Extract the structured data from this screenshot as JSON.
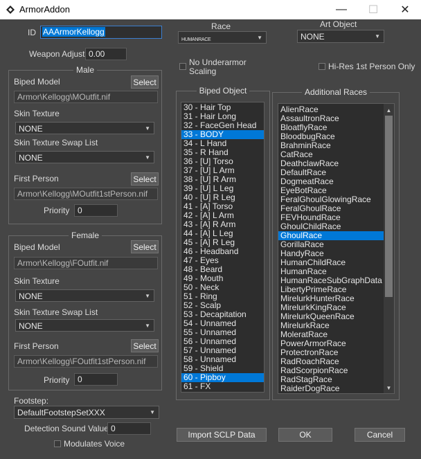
{
  "window": {
    "title": "ArmorAddon"
  },
  "id": {
    "label": "ID",
    "value": "AAArmorKellogg"
  },
  "weapon_adjust": {
    "label": "Weapon Adjust",
    "value": "0.00"
  },
  "male": {
    "title": "Male",
    "biped_model": {
      "label": "Biped Model",
      "button": "Select",
      "value": "Armor\\Kellogg\\MOutfit.nif"
    },
    "skin_texture": {
      "label": "Skin Texture",
      "value": "NONE"
    },
    "skin_swap": {
      "label": "Skin Texture Swap List",
      "value": "NONE"
    },
    "first_person": {
      "label": "First Person",
      "button": "Select",
      "value": "Armor\\Kellogg\\MOutfit1stPerson.nif"
    },
    "priority": {
      "label": "Priority",
      "value": "0"
    }
  },
  "female": {
    "title": "Female",
    "biped_model": {
      "label": "Biped Model",
      "button": "Select",
      "value": "Armor\\Kellogg\\FOutfit.nif"
    },
    "skin_texture": {
      "label": "Skin Texture",
      "value": "NONE"
    },
    "skin_swap": {
      "label": "Skin Texture Swap List",
      "value": "NONE"
    },
    "first_person": {
      "label": "First Person",
      "button": "Select",
      "value": "Armor\\Kellogg\\FOutfit1stPerson.nif"
    },
    "priority": {
      "label": "Priority",
      "value": "0"
    }
  },
  "footstep": {
    "label": "Footstep:",
    "value": "DefaultFootstepSetXXX"
  },
  "detection_sound": {
    "label": "Detection Sound Value",
    "value": "0"
  },
  "modulates_voice": {
    "label": "Modulates Voice",
    "checked": false
  },
  "race": {
    "label": "Race",
    "value": "HUMANRACE"
  },
  "art_object": {
    "label": "Art Object",
    "value": "NONE"
  },
  "no_underarmor": {
    "label_line1": "No Underarmor",
    "label_line2": "Scaling",
    "checked": false
  },
  "hires_1st": {
    "label": "Hi-Res 1st Person Only",
    "checked": false
  },
  "biped_object": {
    "title": "Biped Object",
    "items": [
      {
        "text": "30 - Hair Top",
        "selected": false
      },
      {
        "text": "31 - Hair Long",
        "selected": false
      },
      {
        "text": "32 - FaceGen Head",
        "selected": false
      },
      {
        "text": "33 - BODY",
        "selected": true
      },
      {
        "text": "34 - L Hand",
        "selected": false
      },
      {
        "text": "35 - R Hand",
        "selected": false
      },
      {
        "text": "36 - [U] Torso",
        "selected": false
      },
      {
        "text": "37 - [U] L Arm",
        "selected": false
      },
      {
        "text": "38 - [U] R Arm",
        "selected": false
      },
      {
        "text": "39 - [U] L Leg",
        "selected": false
      },
      {
        "text": "40 - [U] R Leg",
        "selected": false
      },
      {
        "text": "41 - [A] Torso",
        "selected": false
      },
      {
        "text": "42 - [A] L Arm",
        "selected": false
      },
      {
        "text": "43 - [A] R Arm",
        "selected": false
      },
      {
        "text": "44 - [A] L Leg",
        "selected": false
      },
      {
        "text": "45 - [A] R Leg",
        "selected": false
      },
      {
        "text": "46 - Headband",
        "selected": false
      },
      {
        "text": "47 - Eyes",
        "selected": false
      },
      {
        "text": "48 - Beard",
        "selected": false
      },
      {
        "text": "49 - Mouth",
        "selected": false
      },
      {
        "text": "50 - Neck",
        "selected": false
      },
      {
        "text": "51 - Ring",
        "selected": false
      },
      {
        "text": "52 - Scalp",
        "selected": false
      },
      {
        "text": "53 - Decapitation",
        "selected": false
      },
      {
        "text": "54 - Unnamed",
        "selected": false
      },
      {
        "text": "55 - Unnamed",
        "selected": false
      },
      {
        "text": "56 - Unnamed",
        "selected": false
      },
      {
        "text": "57 - Unnamed",
        "selected": false
      },
      {
        "text": "58 - Unnamed",
        "selected": false
      },
      {
        "text": "59 - Shield",
        "selected": false
      },
      {
        "text": "60 - Pipboy",
        "selected": true
      },
      {
        "text": "61 - FX",
        "selected": false
      }
    ]
  },
  "additional_races": {
    "title": "Additional Races",
    "items": [
      {
        "text": "AlienRace",
        "selected": false
      },
      {
        "text": "AssaultronRace",
        "selected": false
      },
      {
        "text": "BloatflyRace",
        "selected": false
      },
      {
        "text": "BloodbugRace",
        "selected": false
      },
      {
        "text": "BrahminRace",
        "selected": false
      },
      {
        "text": "CatRace",
        "selected": false
      },
      {
        "text": "DeathclawRace",
        "selected": false
      },
      {
        "text": "DefaultRace",
        "selected": false
      },
      {
        "text": "DogmeatRace",
        "selected": false
      },
      {
        "text": "EyeBotRace",
        "selected": false
      },
      {
        "text": "FeralGhoulGlowingRace",
        "selected": false
      },
      {
        "text": "FeralGhoulRace",
        "selected": false
      },
      {
        "text": "FEVHoundRace",
        "selected": false
      },
      {
        "text": "GhoulChildRace",
        "selected": false
      },
      {
        "text": "GhoulRace",
        "selected": true
      },
      {
        "text": "GorillaRace",
        "selected": false
      },
      {
        "text": "HandyRace",
        "selected": false
      },
      {
        "text": "HumanChildRace",
        "selected": false
      },
      {
        "text": "HumanRace",
        "selected": false
      },
      {
        "text": "HumanRaceSubGraphData",
        "selected": false
      },
      {
        "text": "LibertyPrimeRace",
        "selected": false
      },
      {
        "text": "MirelurkHunterRace",
        "selected": false
      },
      {
        "text": "MirelurkKingRace",
        "selected": false
      },
      {
        "text": "MirelurkQueenRace",
        "selected": false
      },
      {
        "text": "MirelurkRace",
        "selected": false
      },
      {
        "text": "MoleratRace",
        "selected": false
      },
      {
        "text": "PowerArmorRace",
        "selected": false
      },
      {
        "text": "ProtectronRace",
        "selected": false
      },
      {
        "text": "RadRoachRace",
        "selected": false
      },
      {
        "text": "RadScorpionRace",
        "selected": false
      },
      {
        "text": "RadStagRace",
        "selected": false
      },
      {
        "text": "RaiderDogRace",
        "selected": false
      }
    ]
  },
  "buttons": {
    "import": "Import SCLP Data",
    "ok": "OK",
    "cancel": "Cancel"
  },
  "colors": {
    "selection": "#0078d7",
    "background": "#454545"
  }
}
